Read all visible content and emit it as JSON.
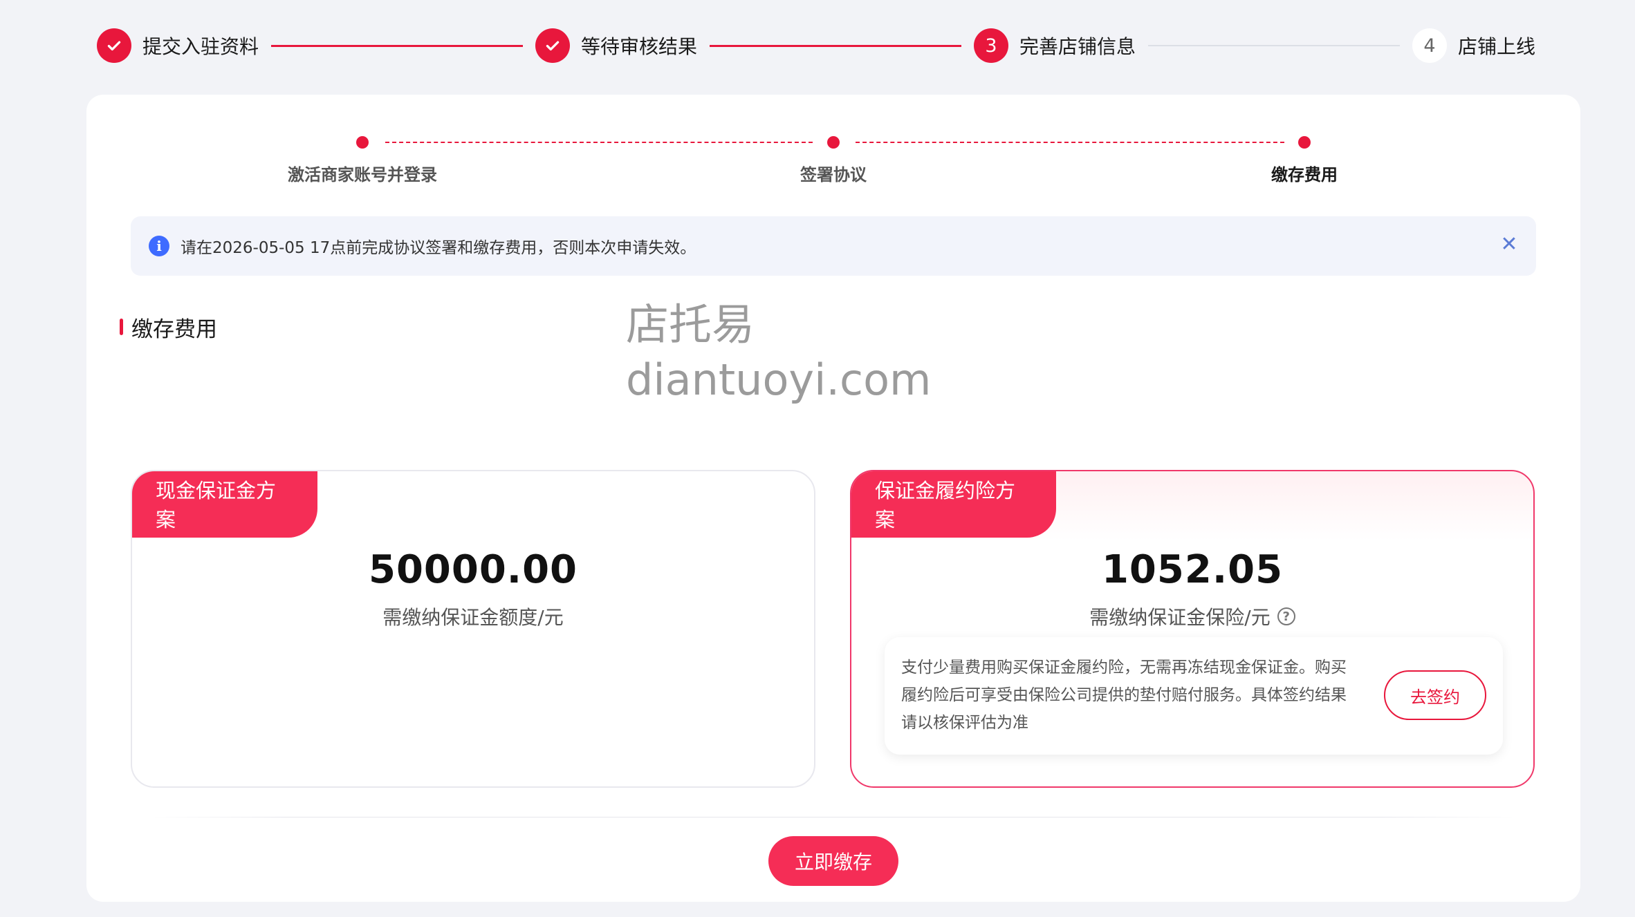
{
  "steps": [
    {
      "label": "提交入驻资料",
      "state": "done"
    },
    {
      "label": "等待审核结果",
      "state": "done"
    },
    {
      "number": "3",
      "label": "完善店铺信息",
      "state": "current"
    },
    {
      "number": "4",
      "label": "店铺上线",
      "state": "pending"
    }
  ],
  "substeps": [
    {
      "label": "激活商家账号并登录"
    },
    {
      "label": "签署协议"
    },
    {
      "label": "缴存费用"
    }
  ],
  "notice": {
    "icon": "info-icon",
    "text": "请在2026-05-05 17点前完成协议签署和缴存费用，否则本次申请失效。",
    "close": "✕"
  },
  "section": {
    "title": "缴存费用"
  },
  "watermark": {
    "line1": "店托易",
    "line2": "diantuoyi.com"
  },
  "plans": {
    "cash": {
      "tag": "现金保证金方案",
      "amount": "50000.00",
      "desc": "需缴纳保证金额度/元"
    },
    "insurance": {
      "tag": "保证金履约险方案",
      "amount": "1052.05",
      "desc": "需缴纳保证金保险/元",
      "help": "?",
      "box_text": "支付少量费用购买保证金履约险，无需再冻结现金保证金。购买履约险后可享受由保险公司提供的垫付赔付服务。具体签约结果请以核保评估为准",
      "sign_label": "去签约"
    }
  },
  "pay_label": "立即缴存",
  "colors": {
    "accent": "#e8173c",
    "tag": "#f52d56",
    "info": "#3e6bff"
  }
}
